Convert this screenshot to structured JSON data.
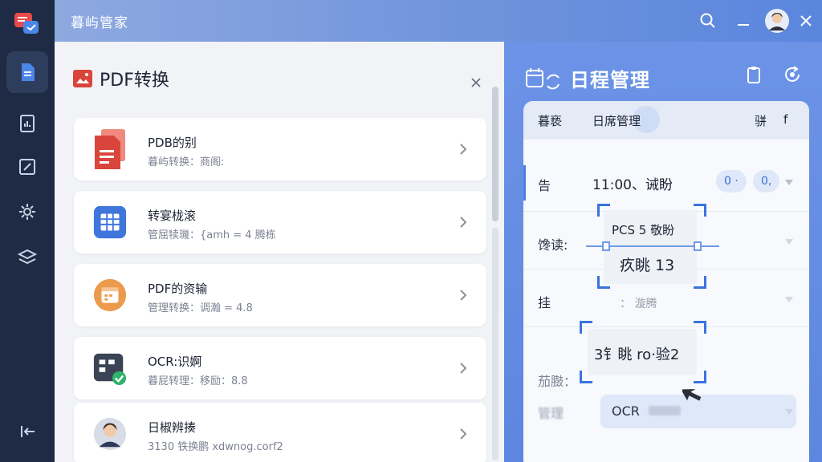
{
  "app": {
    "title": "暮屿管家"
  },
  "colors": {
    "rail": "#1f2b45",
    "accent": "#4f7fe0",
    "schedule": "#6c93e6"
  },
  "rail": {
    "items": [
      {
        "icon": "document-icon",
        "active": true
      },
      {
        "icon": "chart-file-icon",
        "active": false
      },
      {
        "icon": "edit-icon",
        "active": false
      },
      {
        "icon": "gear-icon",
        "active": false
      },
      {
        "icon": "layers-icon",
        "active": false
      }
    ],
    "bottom_icon": "collapse-icon"
  },
  "titlebar": {
    "icons": [
      "search-icon",
      "minimize-icon",
      "avatar",
      "close-icon"
    ]
  },
  "pdf": {
    "title": "PDF转换",
    "items": [
      {
        "title": "PDB的别",
        "subtitle": "暮屿转换：商阁:",
        "icon": "pdf-file-icon"
      },
      {
        "title": "转宴栊滚",
        "subtitle": "管屈犊璣：{amh = 4 腾栋",
        "icon": "spreadsheet-icon"
      },
      {
        "title": "PDF的资输",
        "subtitle": "管理转换：调瀚 = 4.8",
        "icon": "calendar-icon"
      },
      {
        "title": "OCR:识婀",
        "subtitle": "暮屁转理：移励：8.8",
        "icon": "ocr-check-icon"
      },
      {
        "title": "日椒辨揍",
        "subtitle": "3130 铁换鹏 xdwnog.corf2",
        "icon": "person-avatar"
      }
    ]
  },
  "schedule": {
    "title": "日程管理",
    "tabs": [
      "暮亵",
      "日席管理",
      "骈",
      "f"
    ],
    "rows": [
      {
        "label": "告",
        "time": "11:00、诫盼",
        "pills": [
          "0 ·",
          "0,"
        ]
      },
      {
        "label": "馋读:",
        "time": "",
        "pills": []
      },
      {
        "label": "挂",
        "time": "",
        "sub": "： 漩腾",
        "pills": []
      },
      {
        "label": "茄臌：",
        "time": "",
        "pills": []
      },
      {
        "label": "管理",
        "time": "",
        "pills": []
      }
    ],
    "popup1": {
      "line1": "PCS 5  敬盼",
      "line2": "疚眺 13"
    },
    "popup2": {
      "text": "3钅眺 ro·验2"
    },
    "ocr_bar": "OCR"
  }
}
